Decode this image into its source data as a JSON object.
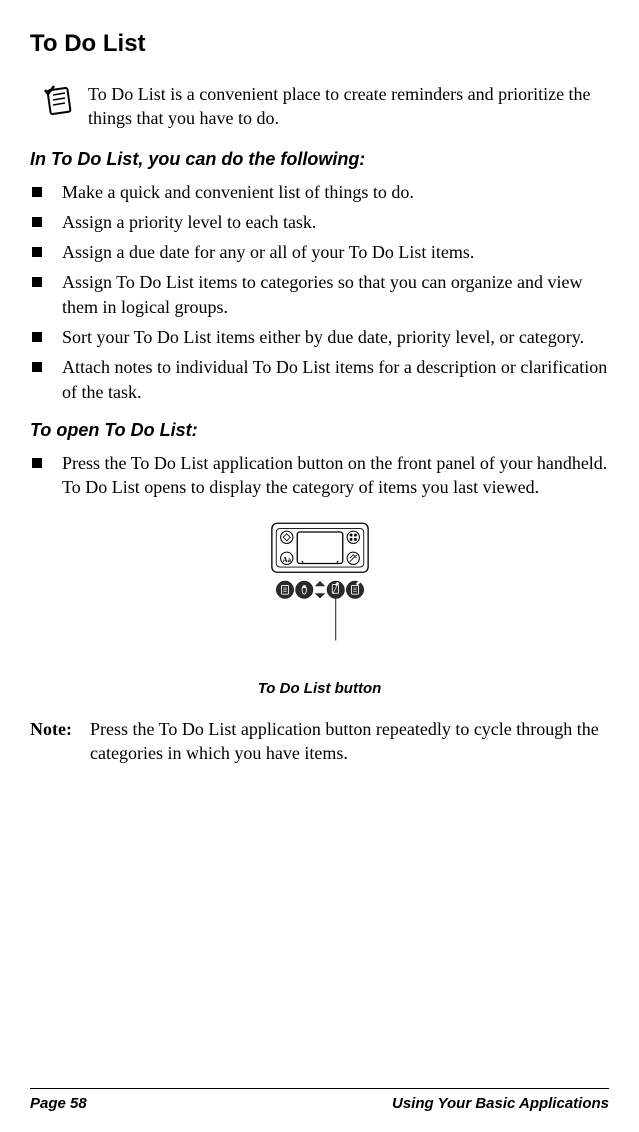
{
  "title": "To Do List",
  "intro": "To Do List is a convenient place to create reminders and prioritize the things that you have to do.",
  "section1": {
    "heading": "In To Do List, you can do the following:",
    "bullets": [
      "Make a quick and convenient list of things to do.",
      "Assign a priority level to each task.",
      "Assign a due date for any or all of your To Do List items.",
      "Assign To Do List items to categories so that you can organize and view them in logical groups.",
      "Sort your To Do List items either by due date, priority level, or category.",
      "Attach notes to individual To Do List items for a description or clarification of the task."
    ]
  },
  "section2": {
    "heading": "To open To Do List:",
    "bullets": [
      "Press the To Do List application button on the front panel of your handheld. To Do List opens to display the category of items you last viewed."
    ]
  },
  "figure": {
    "label": "To Do List button"
  },
  "note": {
    "label": "Note:",
    "text": "Press the To Do List application button repeatedly to cycle through the categories in which you have items."
  },
  "footer": {
    "page": "Page 58",
    "chapter": "Using Your Basic Applications"
  }
}
